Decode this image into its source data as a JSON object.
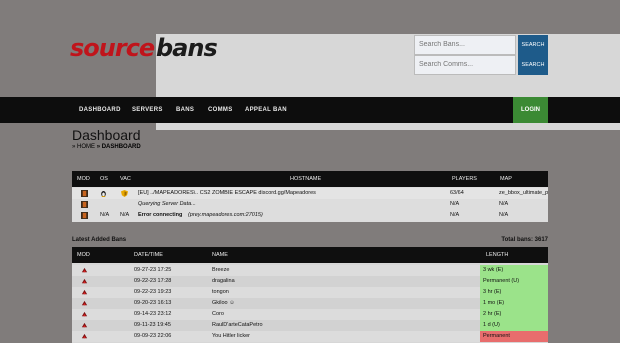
{
  "header": {
    "logo_part1": "source",
    "logo_part2": "bans",
    "search_bans_placeholder": "Search Bans...",
    "search_comms_placeholder": "Search Comms...",
    "search_button_label": "SEARCH"
  },
  "nav": {
    "items": [
      "DASHBOARD",
      "SERVERS",
      "BANS",
      "COMMS",
      "APPEAL BAN"
    ],
    "login_label": "LOGIN"
  },
  "page": {
    "title": "Dashboard",
    "breadcrumb_home": "» HOME",
    "breadcrumb_current": "» DASHBOARD"
  },
  "servers": {
    "columns": [
      "MOD",
      "OS",
      "VAC",
      "HOSTNAME",
      "PLAYERS",
      "MAP"
    ],
    "rows": [
      {
        "vac": "",
        "hostname": "[EU] ../MAPEADORES\\.. CS2 ZOMBIE ESCAPE discord.gg/Mapeadores",
        "players": "63/64",
        "map": "ze_bbox_ultimate_p"
      },
      {
        "vac": "",
        "hostname": "Querying Server Data...",
        "players": "N/A",
        "map": "N/A"
      },
      {
        "os": "N/A",
        "vac": "N/A",
        "hostname_bold": "Error connecting",
        "hostname": " (prey.mapeadores.com:27015)",
        "players": "N/A",
        "map": "N/A"
      }
    ]
  },
  "latest_bans": {
    "section_title": "Latest Added Bans",
    "total_label": "Total bans: 3617",
    "columns": [
      "MOD",
      "DATE/TIME",
      "NAME",
      "LENGTH"
    ],
    "rows": [
      {
        "datetime": "09-27-23 17:25",
        "name": "Breeze",
        "length": "3 wk (E)",
        "status": "expired"
      },
      {
        "datetime": "09-22-23 17:28",
        "name": "dragalina",
        "length": "Permanent (U)",
        "status": "expired"
      },
      {
        "datetime": "09-22-23 19:23",
        "name": "tongon",
        "length": "3 hr (E)",
        "status": "expired"
      },
      {
        "datetime": "09-20-23 16:13",
        "name": "Gkiloo ☺",
        "length": "1 mo (E)",
        "status": "expired"
      },
      {
        "datetime": "09-14-23 23:12",
        "name": "Coro",
        "length": "2 hr (E)",
        "status": "expired"
      },
      {
        "datetime": "09-11-23 19:45",
        "name": "RaulD'arteCataPetro",
        "length": "1 d (U)",
        "status": "expired"
      },
      {
        "datetime": "09-09-23 22:06",
        "name": "You Hitler licker",
        "length": "Permanent",
        "status": "active"
      }
    ]
  },
  "colors": {
    "background": "#807c7b",
    "nav_bg": "#0d0d0d",
    "login_bg": "#3b8a34",
    "search_btn": "#1e5b8a",
    "expired": "#9be38a",
    "active": "#e86d6d"
  }
}
